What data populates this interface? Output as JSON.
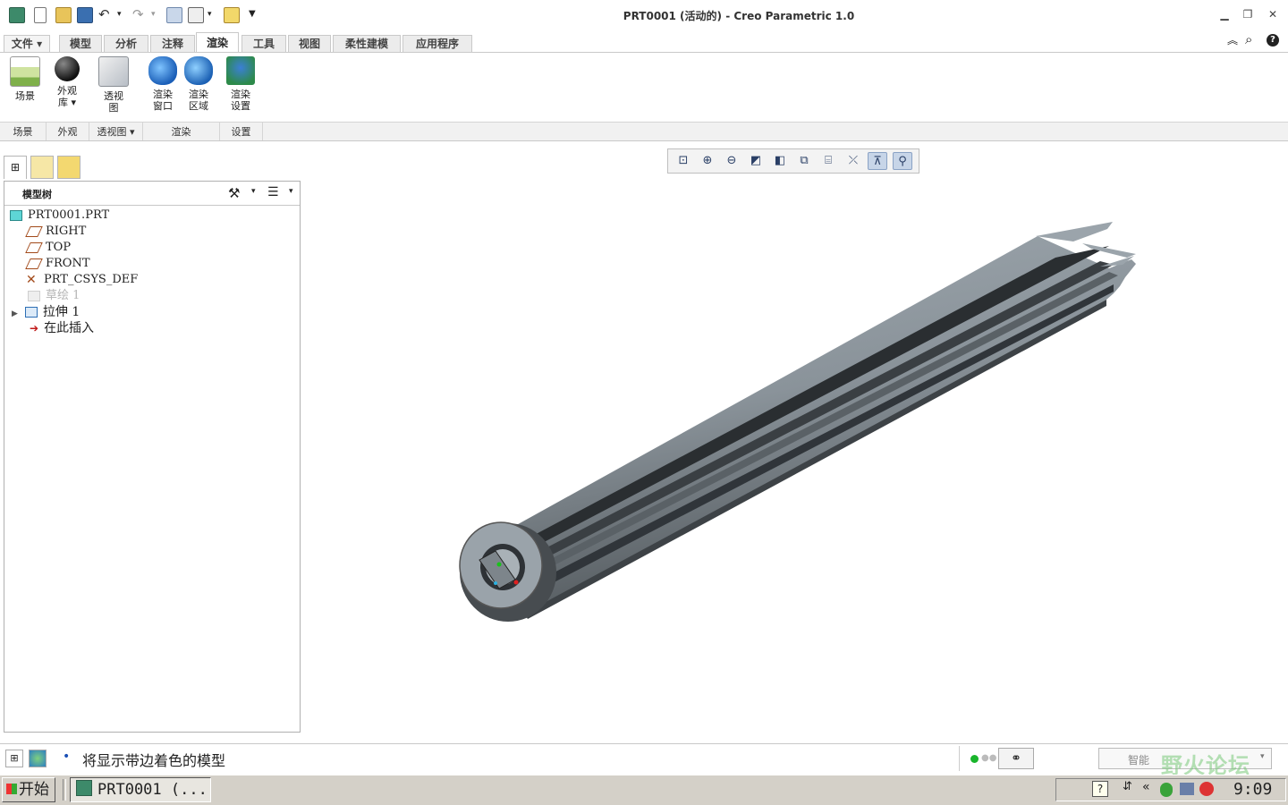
{
  "window": {
    "title": "PRT0001 (活动的) - Creo Parametric 1.0"
  },
  "tabs": [
    {
      "label": "文件",
      "active": false
    },
    {
      "label": "模型",
      "active": false
    },
    {
      "label": "分析",
      "active": false
    },
    {
      "label": "注释",
      "active": false
    },
    {
      "label": "渲染",
      "active": true
    },
    {
      "label": "工具",
      "active": false
    },
    {
      "label": "视图",
      "active": false
    },
    {
      "label": "柔性建模",
      "active": false
    },
    {
      "label": "应用程序",
      "active": false
    }
  ],
  "ribbon": {
    "buttons": [
      {
        "line1": "场景",
        "line2": ""
      },
      {
        "line1": "外观",
        "line2": "库 ▾"
      },
      {
        "line1": "透视",
        "line2": "图"
      },
      {
        "line1": "渲染",
        "line2": "窗口"
      },
      {
        "line1": "渲染",
        "line2": "区域"
      },
      {
        "line1": "渲染",
        "line2": "设置"
      }
    ],
    "groups": [
      "场景",
      "外观",
      "透视图 ▾",
      "渲染",
      "设置"
    ]
  },
  "model_tree": {
    "header": "模型树",
    "items": [
      {
        "label": "PRT0001.PRT",
        "icon": "part-icon"
      },
      {
        "label": "RIGHT",
        "icon": "datum-plane-icon"
      },
      {
        "label": "TOP",
        "icon": "datum-plane-icon"
      },
      {
        "label": "FRONT",
        "icon": "datum-plane-icon"
      },
      {
        "label": "PRT_CSYS_DEF",
        "icon": "csys-icon"
      },
      {
        "label": "草绘 1",
        "icon": "sketch-icon"
      },
      {
        "label": "拉伸 1",
        "icon": "extrude-icon"
      },
      {
        "label": "在此插入",
        "icon": "insert-arrow-icon"
      }
    ]
  },
  "status": {
    "message": "将显示带边着色的模型",
    "filter": "智能"
  },
  "taskbar": {
    "start_label": "开始",
    "task_label": "PRT0001 (...",
    "clock": "9:09"
  },
  "watermark": "野火论坛",
  "colors": {
    "tab_active_bg": "#ffffff",
    "ribbon_group_bg": "#f1f1f1",
    "model_gray": "#8c959c",
    "taskbar_bg": "#d4d0c8"
  }
}
